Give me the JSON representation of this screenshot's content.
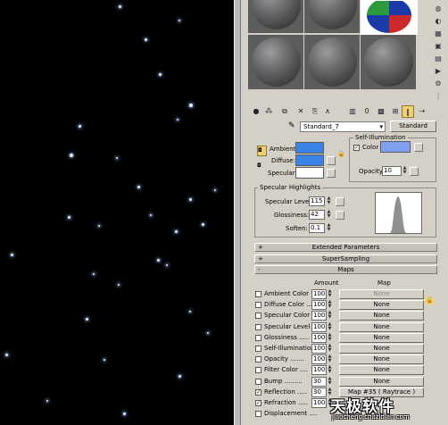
{
  "material": {
    "name": "Standard_7",
    "type_button": "Standard"
  },
  "toolbar": {
    "icons": [
      "get-material-icon",
      "put-to-scene-icon",
      "assign-icon",
      "reset-icon",
      "copy-icon",
      "unique-icon",
      "put-library-icon",
      "effects-channel-icon",
      "show-map-icon",
      "show-end-result-icon",
      "go-parent-icon",
      "go-sibling-icon"
    ]
  },
  "basic_params": {
    "ambient_label": "Ambient:",
    "diffuse_label": "Diffuse:",
    "specular_label": "Specular:",
    "ambient_color": "#3a84e8",
    "diffuse_color": "#3a84e8",
    "specular_color": "#ffffff",
    "lock_glyph": "🔒",
    "self_illum_title": "Self-Illumination",
    "color_label": "Color",
    "self_illum_color": "#7fa0f0",
    "opacity_label": "Opacity:",
    "opacity_value": "10"
  },
  "specular_highlights": {
    "title": "Specular Highlights",
    "level_label": "Specular Level:",
    "level_value": "115",
    "gloss_label": "Glossiness:",
    "gloss_value": "42",
    "soften_label": "Soften:",
    "soften_value": "0.1"
  },
  "rollouts": {
    "extended": {
      "sign": "+",
      "title": "Extended Parameters"
    },
    "supersampling": {
      "sign": "+",
      "title": "SuperSampling"
    },
    "maps": {
      "sign": "-",
      "title": "Maps"
    }
  },
  "maps": {
    "amount_header": "Amount",
    "map_header": "Map",
    "rows": [
      {
        "label": "Ambient Color ..",
        "amount": "100",
        "map": "None",
        "checked": ""
      },
      {
        "label": "Diffuse Color ...",
        "amount": "100",
        "map": "None",
        "checked": ""
      },
      {
        "label": "Specular Color ..",
        "amount": "100",
        "map": "None",
        "checked": ""
      },
      {
        "label": "Specular Level ..",
        "amount": "100",
        "map": "None",
        "checked": ""
      },
      {
        "label": "Glossiness .....",
        "amount": "100",
        "map": "None",
        "checked": ""
      },
      {
        "label": "Self-Illumination .",
        "amount": "100",
        "map": "None",
        "checked": ""
      },
      {
        "label": "Opacity .......",
        "amount": "100",
        "map": "None",
        "checked": ""
      },
      {
        "label": "Filter Color ....",
        "amount": "100",
        "map": "None",
        "checked": ""
      },
      {
        "label": "Bump .........",
        "amount": "30",
        "map": "None",
        "checked": ""
      },
      {
        "label": "Reflection .....",
        "amount": "30",
        "map": "Map #35 ( Raytrace )",
        "checked": "✓"
      },
      {
        "label": "Refraction .....",
        "amount": "100",
        "map": "",
        "checked": "✓"
      },
      {
        "label": "Displacement ....",
        "amount": "",
        "map": "",
        "checked": ""
      }
    ]
  },
  "watermark": {
    "logo": "天极软件",
    "site": "jiaocheng.chazidian.com"
  }
}
